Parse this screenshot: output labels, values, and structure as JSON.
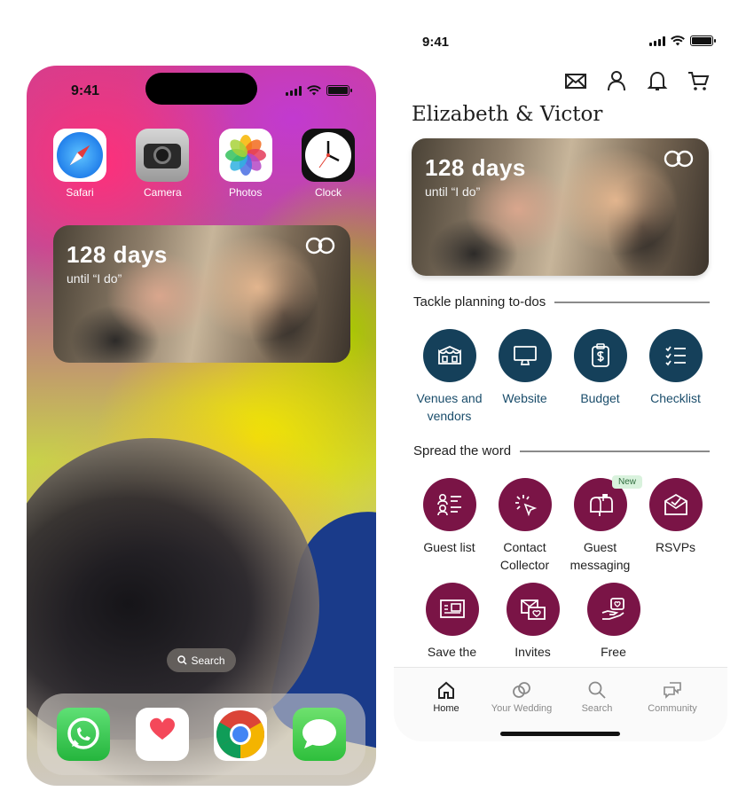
{
  "left_phone": {
    "status_time": "9:41",
    "apps": [
      {
        "label": "Safari",
        "icon": "safari-icon"
      },
      {
        "label": "Camera",
        "icon": "camera-icon"
      },
      {
        "label": "Photos",
        "icon": "photos-icon"
      },
      {
        "label": "Clock",
        "icon": "clock-icon"
      }
    ],
    "widget": {
      "days": "128 days",
      "subtitle": "until “I do”",
      "icon": "rings-icon"
    },
    "search_label": "Search",
    "dock": [
      {
        "app": "WhatsApp",
        "icon": "whatsapp-icon"
      },
      {
        "app": "Health",
        "icon": "health-icon"
      },
      {
        "app": "Chrome",
        "icon": "chrome-icon"
      },
      {
        "app": "Messages",
        "icon": "messages-icon"
      }
    ]
  },
  "right_phone": {
    "status_time": "9:41",
    "top_icons": [
      "mail-icon",
      "profile-icon",
      "bell-icon",
      "cart-icon"
    ],
    "couple_name": "Elizabeth & Victor",
    "widget": {
      "days": "128 days",
      "subtitle": "until “I do”"
    },
    "section_planning": {
      "title": "Tackle planning to-dos",
      "items": [
        {
          "label": "Venues and vendors",
          "icon": "venue-icon"
        },
        {
          "label": "Website",
          "icon": "monitor-icon"
        },
        {
          "label": "Budget",
          "icon": "budget-icon"
        },
        {
          "label": "Checklist",
          "icon": "checklist-icon"
        }
      ]
    },
    "section_spread": {
      "title": "Spread the word",
      "items": [
        {
          "label": "Guest list",
          "icon": "guest-list-icon"
        },
        {
          "label": "Contact Collector",
          "icon": "cursor-click-icon"
        },
        {
          "label": "Guest messaging",
          "icon": "mailbox-icon",
          "badge": "New"
        },
        {
          "label": "RSVPs",
          "icon": "envelope-check-icon"
        },
        {
          "label": "Save the",
          "icon": "save-the-date-icon"
        },
        {
          "label": "Invites",
          "icon": "invites-icon"
        },
        {
          "label": "Free",
          "icon": "gift-hand-icon"
        }
      ]
    },
    "tabs": [
      {
        "label": "Home",
        "icon": "home-icon",
        "active": true
      },
      {
        "label": "Your Wedding",
        "icon": "rings-outline-icon"
      },
      {
        "label": "Search",
        "icon": "search-icon"
      },
      {
        "label": "Community",
        "icon": "chat-bubbles-icon"
      }
    ],
    "colors": {
      "navy": "#15405a",
      "wine": "#7a1446"
    }
  }
}
